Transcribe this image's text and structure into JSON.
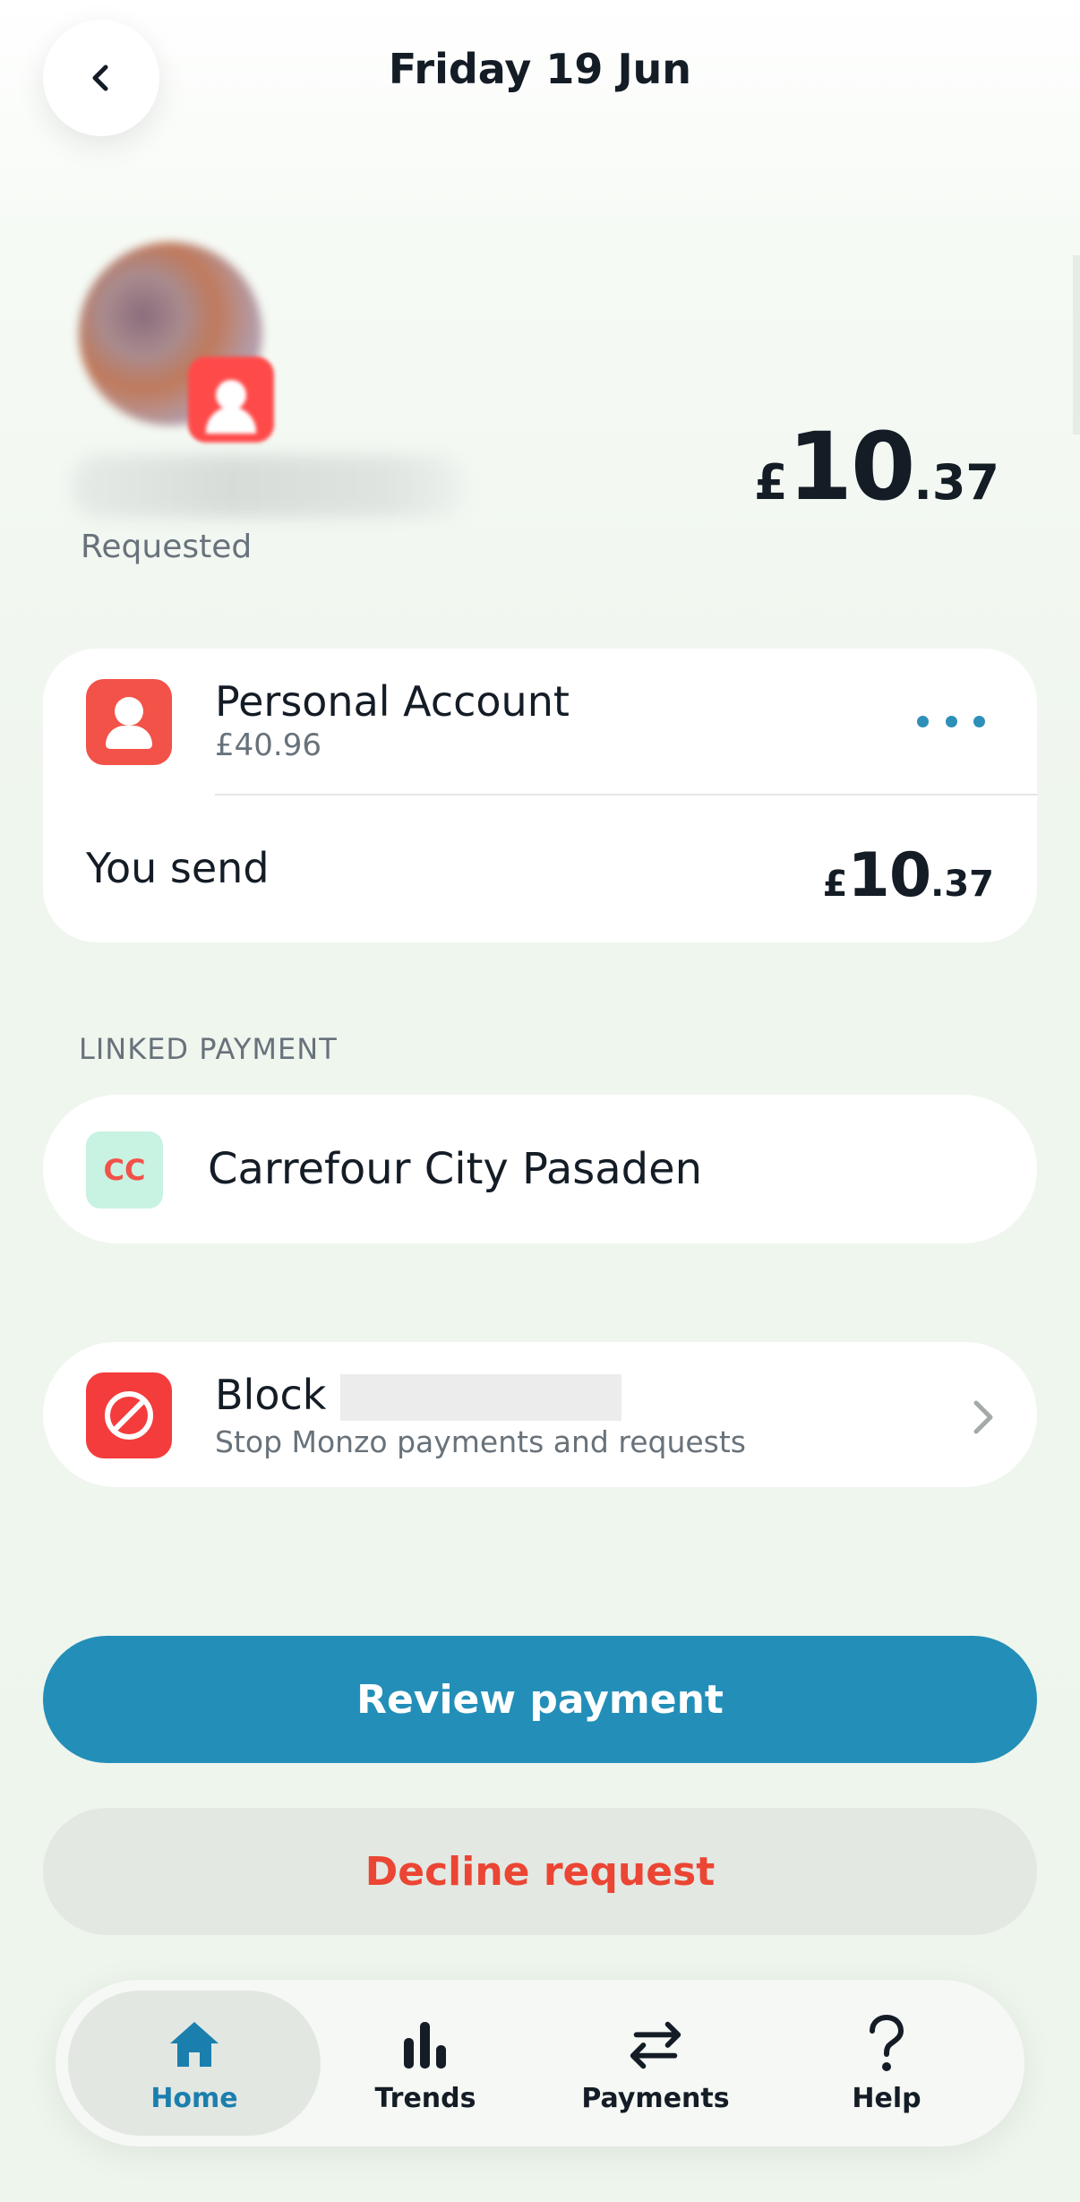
{
  "header": {
    "title": "Friday 19 Jun",
    "back_icon": "chevron-left-icon"
  },
  "request": {
    "status": "Requested",
    "amount": {
      "currency": "£",
      "integer": "10",
      "decimal": ".37"
    }
  },
  "account": {
    "name": "Personal Account",
    "balance": "£40.96",
    "more_icon": "ellipsis-icon",
    "send_label": "You send",
    "send_amount": {
      "currency": "£",
      "integer": "10",
      "decimal": ".37"
    }
  },
  "linked": {
    "section_label": "LINKED PAYMENT",
    "merchant_initials": "CC",
    "merchant_name": "Carrefour City Pasaden"
  },
  "block": {
    "title": "Block",
    "subtitle": "Stop Monzo payments and requests"
  },
  "actions": {
    "review": "Review payment",
    "decline": "Decline request"
  },
  "nav": {
    "home": "Home",
    "trends": "Trends",
    "payments": "Payments",
    "help": "Help"
  },
  "colors": {
    "primary": "#238fb8",
    "danger": "#eb4534",
    "account_icon": "#f25248",
    "merchant_bg": "#c8f2e2"
  }
}
